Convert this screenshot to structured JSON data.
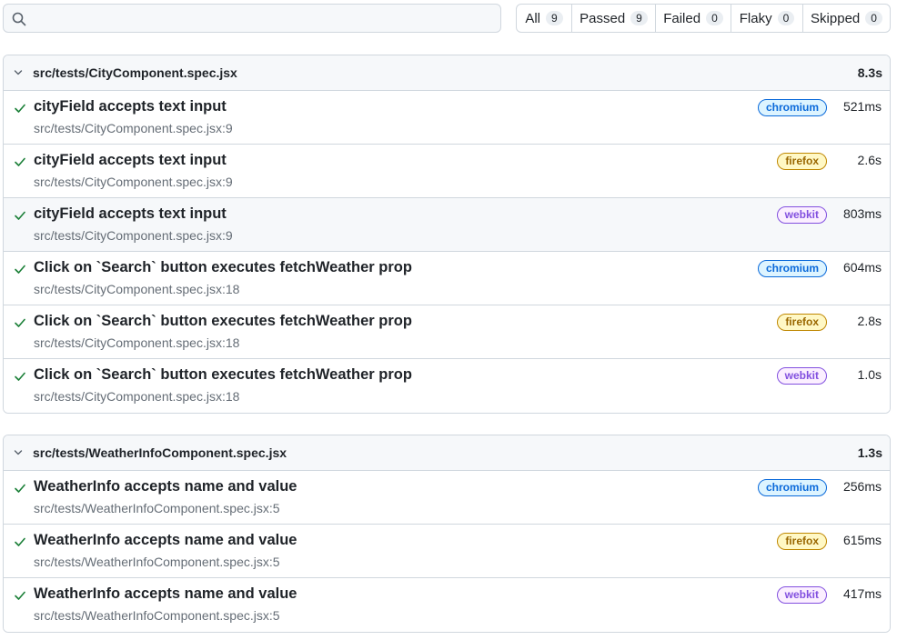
{
  "search": {
    "placeholder": "",
    "value": ""
  },
  "filters": [
    {
      "label": "All",
      "count": "9"
    },
    {
      "label": "Passed",
      "count": "9"
    },
    {
      "label": "Failed",
      "count": "0"
    },
    {
      "label": "Flaky",
      "count": "0"
    },
    {
      "label": "Skipped",
      "count": "0"
    }
  ],
  "groups": [
    {
      "file": "src/tests/CityComponent.spec.jsx",
      "duration": "8.3s",
      "tests": [
        {
          "title": "cityField accepts text input",
          "location": "src/tests/CityComponent.spec.jsx:9",
          "project": "chromium",
          "duration": "521ms"
        },
        {
          "title": "cityField accepts text input",
          "location": "src/tests/CityComponent.spec.jsx:9",
          "project": "firefox",
          "duration": "2.6s"
        },
        {
          "title": "cityField accepts text input",
          "location": "src/tests/CityComponent.spec.jsx:9",
          "project": "webkit",
          "duration": "803ms"
        },
        {
          "title": "Click on `Search` button executes fetchWeather prop",
          "location": "src/tests/CityComponent.spec.jsx:18",
          "project": "chromium",
          "duration": "604ms"
        },
        {
          "title": "Click on `Search` button executes fetchWeather prop",
          "location": "src/tests/CityComponent.spec.jsx:18",
          "project": "firefox",
          "duration": "2.8s"
        },
        {
          "title": "Click on `Search` button executes fetchWeather prop",
          "location": "src/tests/CityComponent.spec.jsx:18",
          "project": "webkit",
          "duration": "1.0s"
        }
      ]
    },
    {
      "file": "src/tests/WeatherInfoComponent.spec.jsx",
      "duration": "1.3s",
      "tests": [
        {
          "title": "WeatherInfo accepts name and value",
          "location": "src/tests/WeatherInfoComponent.spec.jsx:5",
          "project": "chromium",
          "duration": "256ms"
        },
        {
          "title": "WeatherInfo accepts name and value",
          "location": "src/tests/WeatherInfoComponent.spec.jsx:5",
          "project": "firefox",
          "duration": "615ms"
        },
        {
          "title": "WeatherInfo accepts name and value",
          "location": "src/tests/WeatherInfoComponent.spec.jsx:5",
          "project": "webkit",
          "duration": "417ms"
        }
      ]
    }
  ],
  "icons": {
    "search": "search-icon",
    "expand": "chevron-down-icon",
    "status": "check-icon"
  },
  "colors": {
    "passed": "#1a7f37",
    "chromium": "#0969da",
    "firefox": "#9a6700",
    "webkit": "#8250df"
  }
}
